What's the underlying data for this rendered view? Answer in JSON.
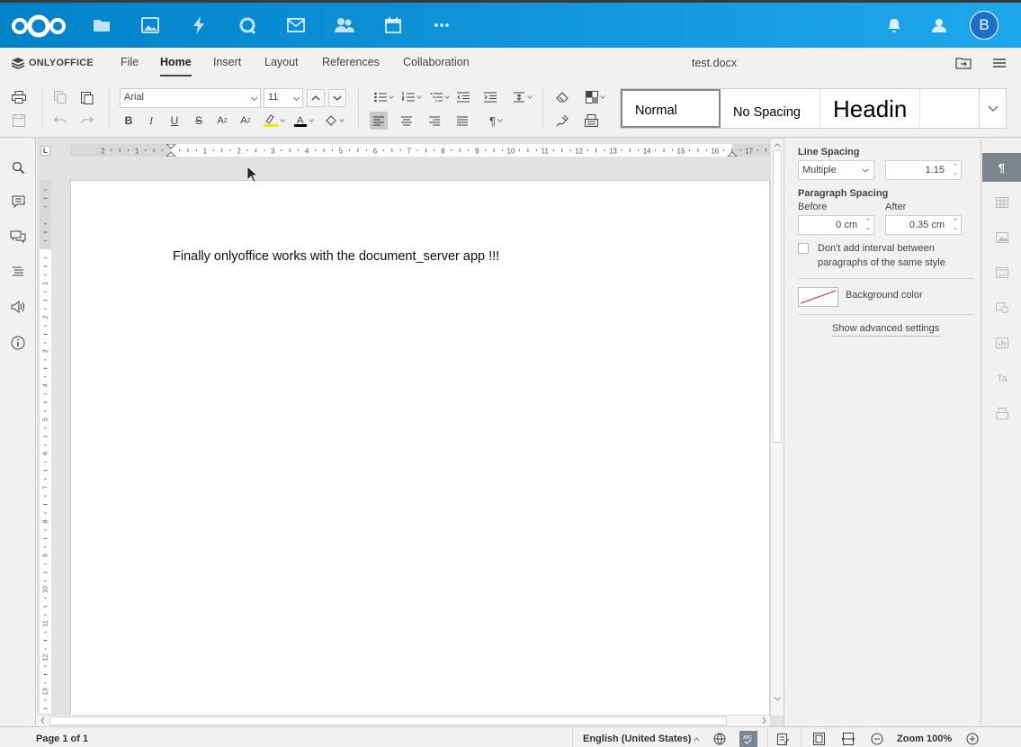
{
  "nextcloud": {
    "apps": [
      "files-icon",
      "photos-icon",
      "activity-icon",
      "talk-icon",
      "mail-icon",
      "contacts-icon",
      "calendar-icon",
      "more-apps-icon"
    ],
    "avatar_letter": "B",
    "brand_color": "#0082c9"
  },
  "onlyoffice": {
    "brand": "ONLYOFFICE",
    "tabs": [
      "File",
      "Home",
      "Insert",
      "Layout",
      "References",
      "Collaboration"
    ],
    "active_tab": "Home",
    "doc_title": "test.docx"
  },
  "toolbar": {
    "font_name": "Arial",
    "font_size": "11",
    "styles": [
      "Normal",
      "No Spacing",
      "Headin"
    ],
    "selected_style": "Normal"
  },
  "document": {
    "text": "Finally onlyoffice works with the document_server app !!!"
  },
  "paragraph_settings": {
    "line_spacing_label": "Line Spacing",
    "line_spacing_type": "Multiple",
    "line_spacing_value": "1.15",
    "paragraph_spacing_label": "Paragraph Spacing",
    "before_label": "Before",
    "before_value": "0 cm",
    "after_label": "After",
    "after_value": "0.35 cm",
    "no_interval_label_1": "Don't add interval between",
    "no_interval_label_2": "paragraphs of the same style",
    "background_color_label": "Background color",
    "advanced_link": "Show advanced settings"
  },
  "ruler": {
    "numbers": [
      "2",
      "1",
      "1",
      "2",
      "3",
      "4",
      "5",
      "6",
      "7",
      "8",
      "9",
      "10",
      "11",
      "12",
      "13",
      "14",
      "15",
      "16",
      "17"
    ],
    "vnumbers": [
      "1",
      "2",
      "3",
      "4",
      "5",
      "6",
      "7",
      "8",
      "9",
      "10",
      "11",
      "12",
      "13"
    ]
  },
  "statusbar": {
    "page_info": "Page 1 of 1",
    "language": "English (United States)",
    "zoom": "Zoom 100%"
  }
}
